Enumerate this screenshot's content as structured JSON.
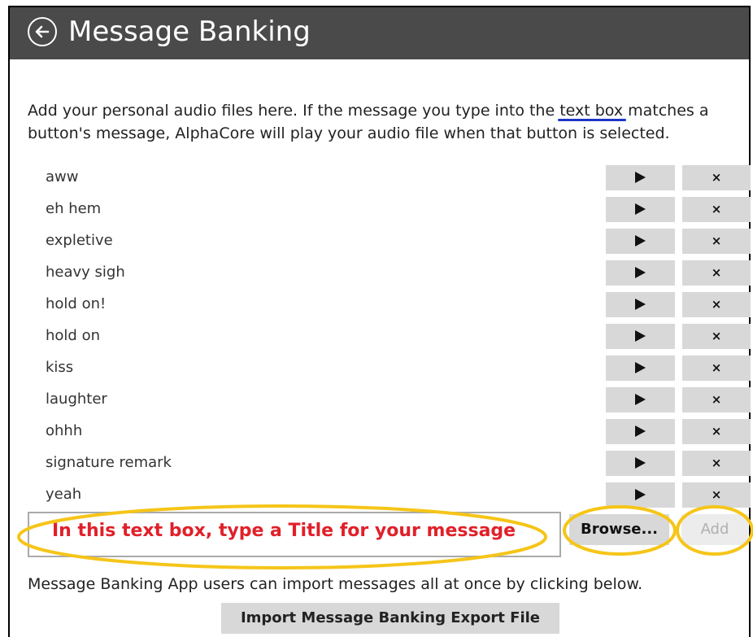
{
  "header": {
    "title": "Message Banking",
    "back_icon": "back-arrow-circle-icon"
  },
  "description": {
    "before_link": "Add your personal audio files here. If the message you type into the ",
    "link": "text box",
    "after_link": " matches a button's message, AlphaCore will play your audio file when that button is selected."
  },
  "messages": [
    {
      "label": "aww"
    },
    {
      "label": "eh hem"
    },
    {
      "label": "expletive"
    },
    {
      "label": "heavy sigh"
    },
    {
      "label": "hold on!"
    },
    {
      "label": "hold on"
    },
    {
      "label": "kiss"
    },
    {
      "label": "laughter"
    },
    {
      "label": "ohhh"
    },
    {
      "label": "signature remark"
    },
    {
      "label": "yeah"
    }
  ],
  "row_buttons": {
    "play_icon": "play-icon",
    "delete_label": "×"
  },
  "add_form": {
    "annotation": "In this text box, type a Title for your message",
    "browse_label": "Browse...",
    "add_label": "Add"
  },
  "import": {
    "note": "Message Banking App users can import messages all at once by clicking below.",
    "button_label": "Import Message Banking Export File"
  },
  "colors": {
    "header_bg": "#4a4a4a",
    "button_bg": "#d8d8d8",
    "annotation_red": "#e0202a",
    "highlight_yellow": "#f5c518",
    "underline_blue": "#1a36c8"
  }
}
